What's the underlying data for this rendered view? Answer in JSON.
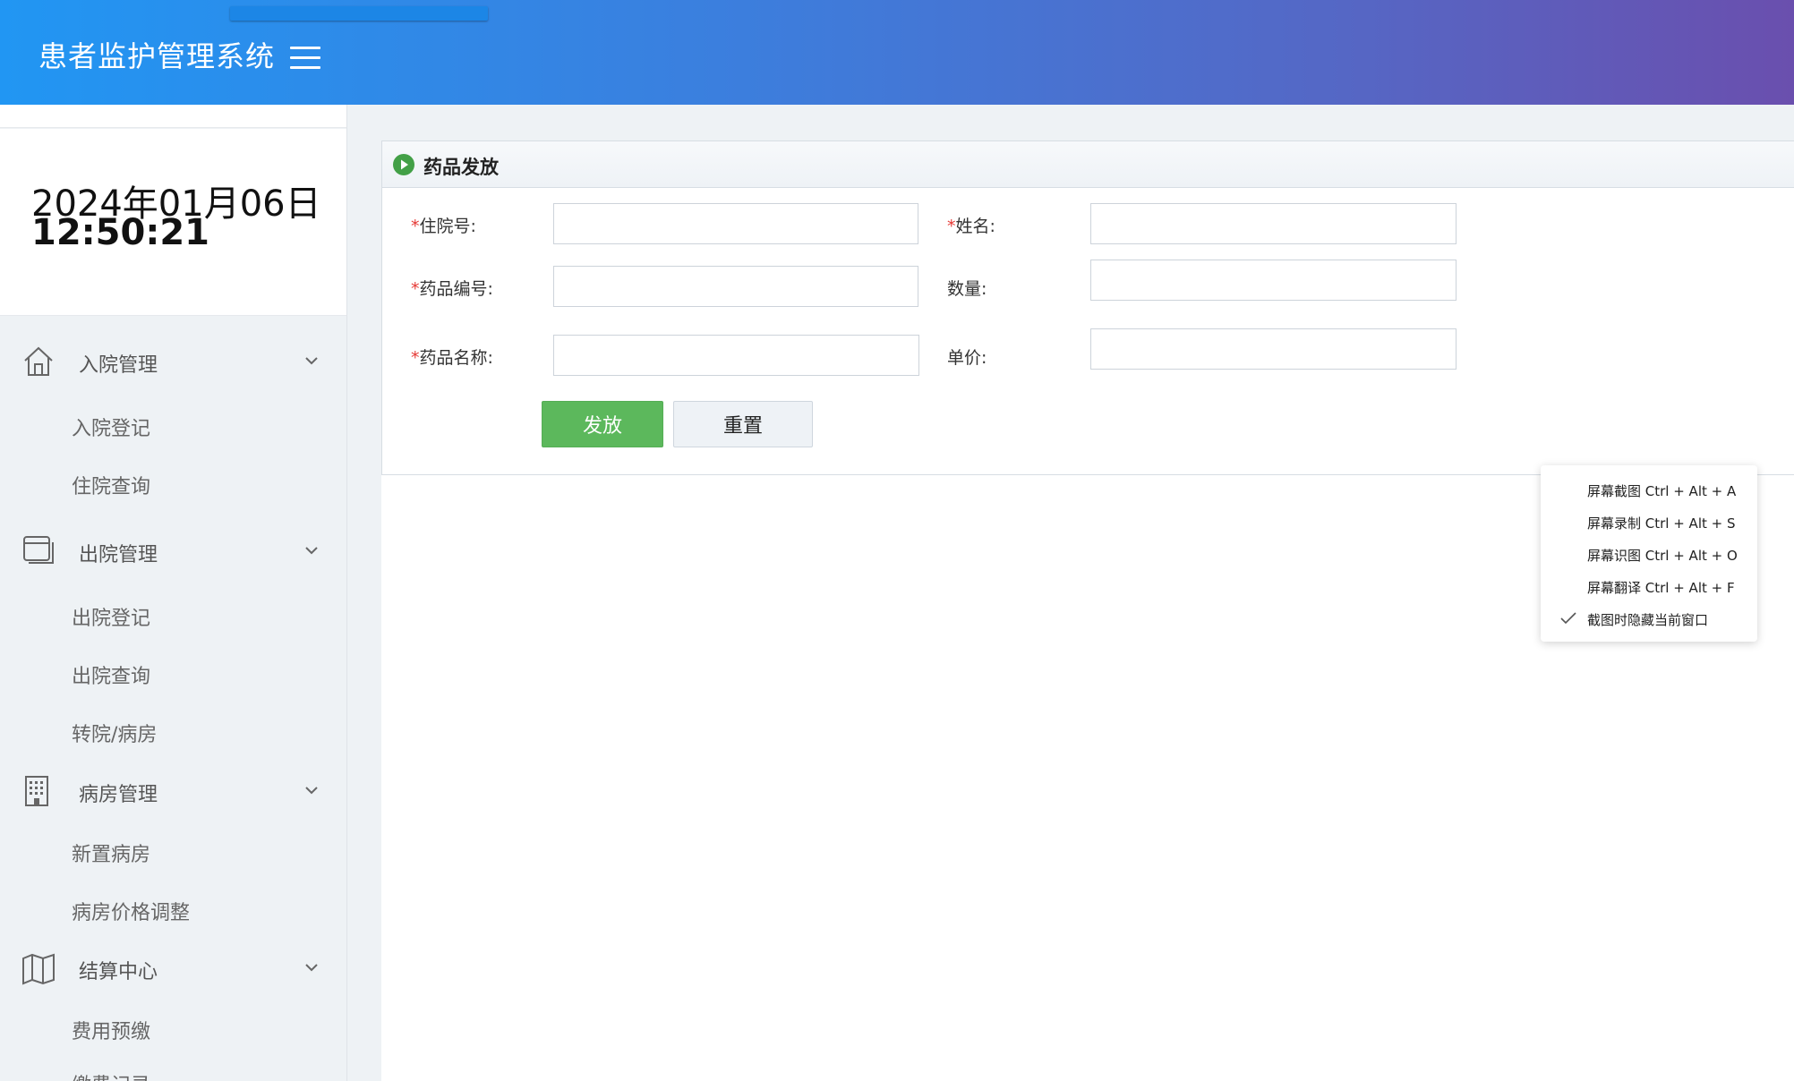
{
  "header": {
    "app_title": "患者监护管理系统",
    "menu_icon": "hamburger-icon",
    "gradient_start": "#2196f3",
    "gradient_end": "#6a4fae"
  },
  "sidebar": {
    "clock": {
      "date": "2024年01月06日",
      "time": "12:50:21"
    },
    "groups": [
      {
        "label": "入院管理",
        "icon": "home-icon",
        "items": [
          "入院登记",
          "住院查询"
        ]
      },
      {
        "label": "出院管理",
        "icon": "window-icon",
        "items": [
          "出院登记",
          "出院查询",
          "转院/病房"
        ]
      },
      {
        "label": "病房管理",
        "icon": "building-icon",
        "items": [
          "新置病房",
          "病房价格调整"
        ]
      },
      {
        "label": "结算中心",
        "icon": "map-icon",
        "items": [
          "费用预缴",
          "缴费记录"
        ]
      }
    ]
  },
  "panel": {
    "title": "药品发放",
    "title_icon": "play-circle-icon",
    "fields": {
      "admission_no": {
        "label": "住院号:",
        "required": true,
        "value": ""
      },
      "name": {
        "label": "姓名:",
        "required": true,
        "value": ""
      },
      "drug_code": {
        "label": "药品编号:",
        "required": true,
        "value": ""
      },
      "quantity": {
        "label": "数量:",
        "required": false,
        "value": ""
      },
      "drug_name": {
        "label": "药品名称:",
        "required": true,
        "value": ""
      },
      "unit": {
        "label": "单价:",
        "required": false,
        "value": ""
      }
    },
    "required_mark": "*",
    "buttons": {
      "submit": "发放",
      "reset": "重置"
    },
    "submit_color": "#5cb85c"
  },
  "context_menu": {
    "items": [
      "屏幕截图 Ctrl + Alt + A",
      "屏幕录制 Ctrl + Alt + S",
      "屏幕识图 Ctrl + Alt + O",
      "屏幕翻译 Ctrl + Alt + F",
      "截图时隐藏当前窗口"
    ],
    "checked_item": "截图时隐藏当前窗口"
  }
}
